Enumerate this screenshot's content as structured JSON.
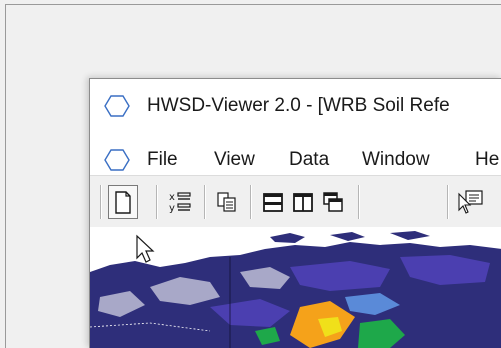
{
  "window": {
    "title": "HWSD-Viewer 2.0 - [WRB Soil Refe",
    "icon": "app-hexagon-icon"
  },
  "menu": {
    "icon": "document-hexagon-icon",
    "items": [
      {
        "label": "File"
      },
      {
        "label": "View"
      },
      {
        "label": "Data"
      },
      {
        "label": "Window"
      },
      {
        "label": "He"
      }
    ]
  },
  "toolbar": {
    "buttons": [
      {
        "icon": "new-document-icon",
        "pressed": true
      },
      {
        "icon": "xy-list-icon"
      },
      {
        "icon": "copy-icon"
      },
      {
        "icon": "tile-horizontal-icon"
      },
      {
        "icon": "tile-vertical-icon"
      },
      {
        "icon": "cascade-windows-icon"
      },
      {
        "icon": "pointer-info-icon"
      }
    ]
  },
  "map": {
    "colors": {
      "background": "#ffffff",
      "dark_blue": "#2e2e7a",
      "indigo": "#4b3fb0",
      "light_gray": "#a8a8c8",
      "orange": "#f5a21a",
      "yellow": "#f0e01a",
      "green": "#1ea84a",
      "sea_blue": "#5a8ad8"
    }
  }
}
